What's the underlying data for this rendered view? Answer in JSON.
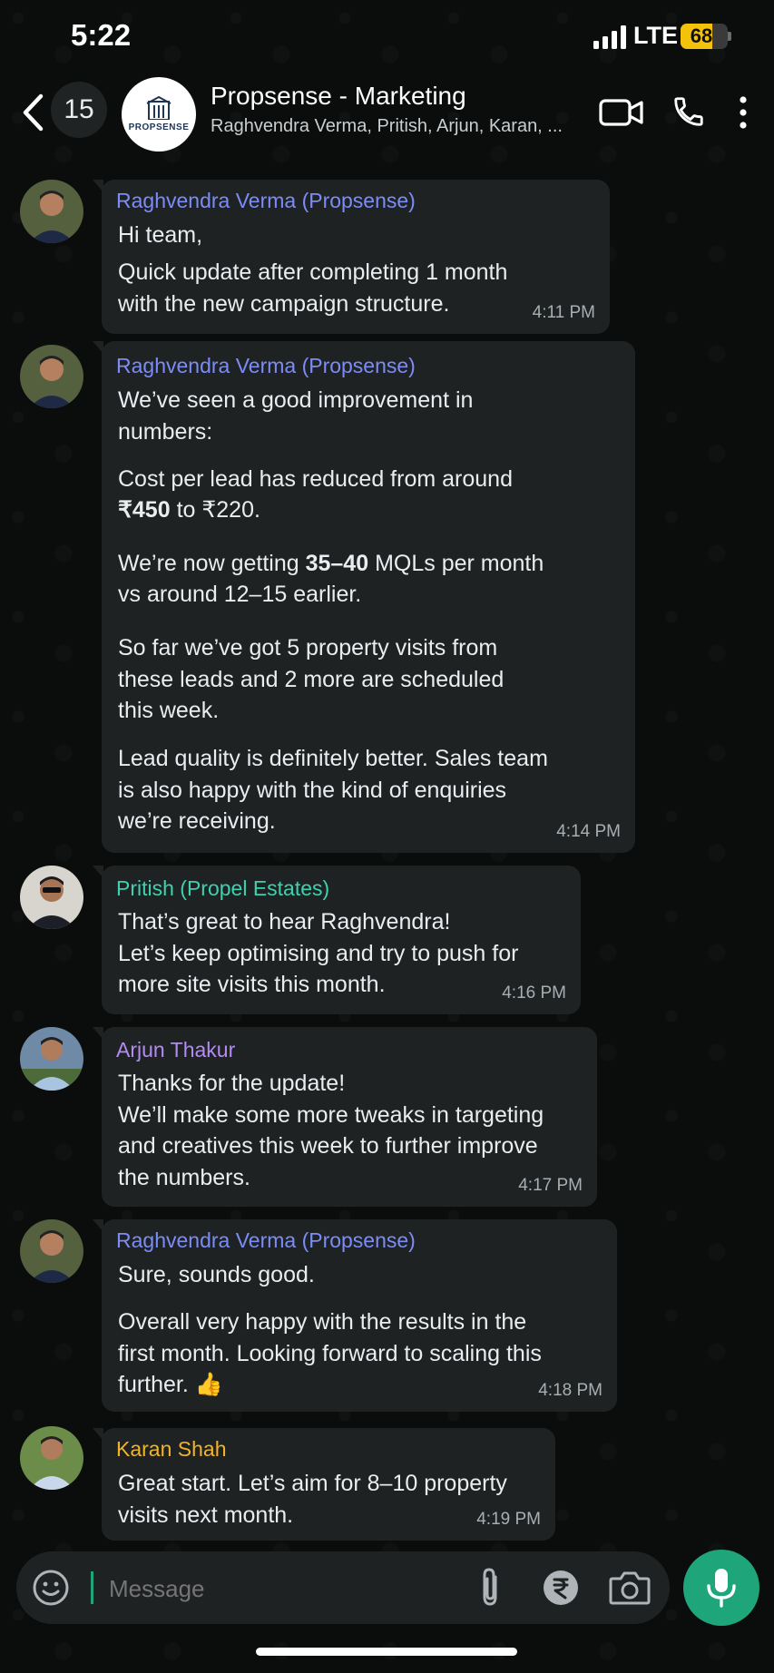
{
  "status_bar": {
    "time": "5:22",
    "network": "LTE",
    "battery": "68",
    "battery_level": 0.68
  },
  "header": {
    "unread_count": "15",
    "group_logo_text": "PROPSENSE",
    "group_name": "Propsense - Marketing",
    "members": "Raghvendra Verma, Pritish, Arjun, Karan, ...",
    "icons": [
      "back-arrow-icon",
      "video-call-icon",
      "phone-icon",
      "more-options-icon"
    ]
  },
  "messages": [
    {
      "sender": "Raghvendra Verma (Propsense)",
      "sender_color": "#7c8cf7",
      "text": "Hi team,",
      "text2": "Quick update after completing 1 month\nwith the new campaign structure.",
      "time": "4:11 PM"
    },
    {
      "sender": "Raghvendra Verma (Propsense)",
      "sender_color": "#7c8cf7",
      "p1": "We’ve seen a good improvement in\nnumbers:",
      "p2a": "Cost per lead has reduced from around",
      "p2b": "₹450",
      "p2c": " to ₹220.",
      "p3a": "We’re now getting ",
      "p3b": "35–40",
      "p3c": " MQLs per month",
      "p3d": "vs around 12–15 earlier.",
      "p4": "So far we’ve got 5 property visits from\nthese leads and 2 more are scheduled\nthis week.",
      "p5": "Lead quality is definitely better. Sales team\nis also happy with the kind of enquiries\nwe’re receiving.",
      "time": "4:14 PM"
    },
    {
      "sender": "Pritish (Propel Estates)",
      "sender_color": "#3ed1b0",
      "text": "That’s great to hear Raghvendra!\nLet’s keep optimising and try to push for\nmore site visits this month.",
      "time": "4:16 PM"
    },
    {
      "sender": "Arjun Thakur",
      "sender_color": "#b28cf0",
      "text": "Thanks for the update!\nWe’ll make some more tweaks in targeting\nand creatives this week to further improve\nthe numbers.",
      "time": "4:17 PM"
    },
    {
      "sender": "Raghvendra Verma (Propsense)",
      "sender_color": "#7c8cf7",
      "p1": "Sure, sounds good.",
      "p2": "Overall very happy with the results in the\nfirst month. Looking forward to scaling this",
      "p3": "further. 👍",
      "time": "4:18 PM"
    },
    {
      "sender": "Karan Shah",
      "sender_color": "#f0b429",
      "text": "Great start. Let’s aim for 8–10 property\nvisits next month.",
      "time": "4:19 PM"
    }
  ],
  "input": {
    "placeholder": "Message",
    "icons": [
      "emoji-icon",
      "attach-icon",
      "rupee-payment-icon",
      "camera-icon",
      "mic-icon"
    ]
  },
  "colors": {
    "accent": "#1ea57a",
    "bubble": "#1f2223",
    "background": "#0b0c0c"
  }
}
